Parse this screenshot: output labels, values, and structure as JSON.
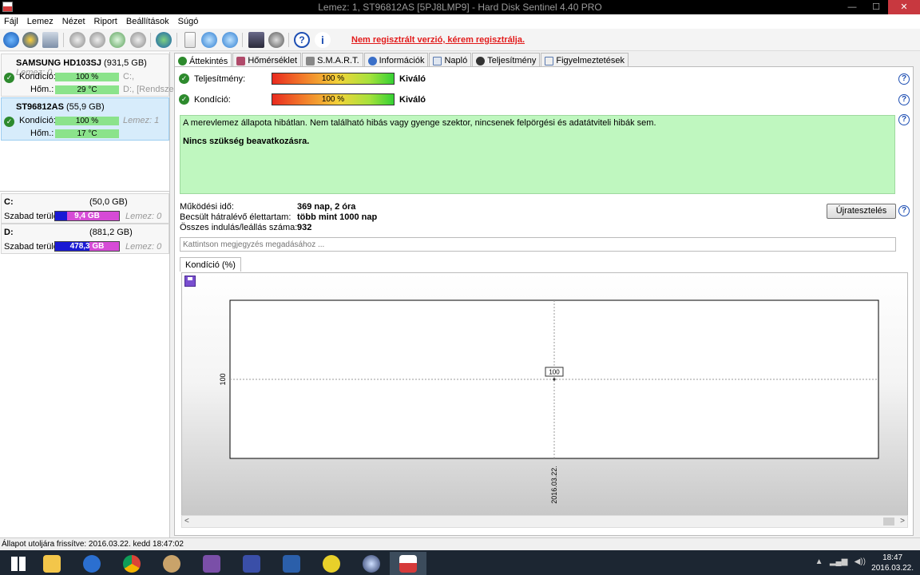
{
  "window": {
    "title": "Lemez: 1, ST96812AS [5PJ8LMP9] - Hard Disk Sentinel 4.40 PRO",
    "minimize": "—",
    "maximize": "☐",
    "close": "✕"
  },
  "menu": [
    "Fájl",
    "Lemez",
    "Nézet",
    "Riport",
    "Beállítások",
    "Súgó"
  ],
  "toolbar": {
    "unregistered_text": "Nem regisztrált verzió, kérem regisztrálja."
  },
  "disks": [
    {
      "model": "SAMSUNG HD103SJ",
      "size": "(931,5 GB)",
      "note": "Lemez: 0",
      "condition_label": "Kondíció:",
      "condition_value": "100 %",
      "temp_label": "Hőm.:",
      "temp_value": "29 °C",
      "partitions_line1": "C:,",
      "partitions_line2": "D:, [Rendszer"
    },
    {
      "model": "ST96812AS",
      "size": "(55,9 GB)",
      "note": "Lemez: 1",
      "condition_label": "Kondíció:",
      "condition_value": "100 %",
      "temp_label": "Hőm.:",
      "temp_value": "17 °C"
    }
  ],
  "partitions": [
    {
      "letter": "C:",
      "size": "(50,0 GB)",
      "free_label": "Szabad terület",
      "free_value": "9,4 GB",
      "free_fraction": 0.19,
      "note": "Lemez: 0"
    },
    {
      "letter": "D:",
      "size": "(881,2 GB)",
      "free_label": "Szabad terület",
      "free_value": "478,3 GB",
      "free_fraction": 0.54,
      "note": "Lemez: 0"
    }
  ],
  "tabs": [
    "Áttekintés",
    "Hőmérséklet",
    "S.M.A.R.T.",
    "Információk",
    "Napló",
    "Teljesítmény",
    "Figyelmeztetések"
  ],
  "overview": {
    "performance_label": "Teljesítmény:",
    "performance_value": "100 %",
    "performance_rating": "Kiváló",
    "condition_label": "Kondíció:",
    "condition_value": "100 %",
    "condition_rating": "Kiváló",
    "status_text": "A merevlemez állapota hibátlan. Nem található hibás vagy gyenge szektor, nincsenek felpörgési és adatátviteli hibák sem.",
    "status_action": "Nincs szükség beavatkozásra.",
    "uptime_label": "Működési idő:",
    "uptime_value": "369 nap, 2 óra",
    "remaining_label": "Becsült hátralévő élettartam:",
    "remaining_value": "több mint 1000 nap",
    "startstop_label": "Összes indulás/leállás száma:",
    "startstop_value": "932",
    "retest_button": "Újratesztelés",
    "note_placeholder": "Kattintson megjegyzés megadásához ...",
    "chart_tab": "Kondíció  (%)"
  },
  "chart_data": {
    "type": "line",
    "x": [
      "2016.03.22."
    ],
    "series": [
      {
        "values": [
          100
        ]
      }
    ],
    "data_labels": [
      "100"
    ],
    "ytick": "100",
    "xtick": "2016.03.22."
  },
  "statusbar": {
    "text": "Állapot utoljára frissítve: 2016.03.22. kedd 18:47:02"
  },
  "taskbar": {
    "time": "18:47",
    "date": "2016.03.22."
  }
}
